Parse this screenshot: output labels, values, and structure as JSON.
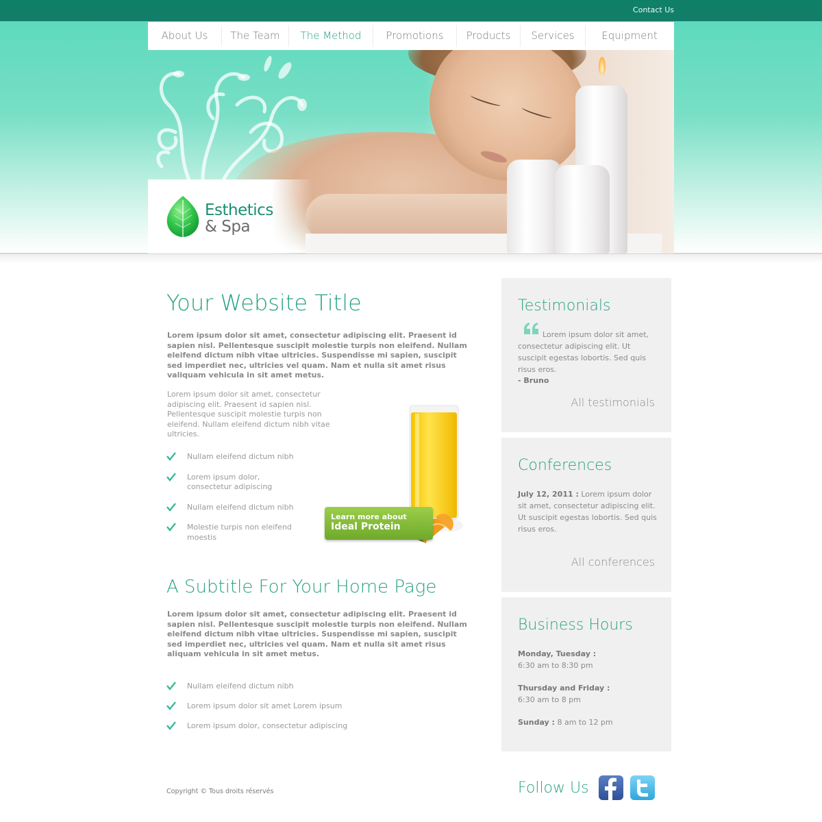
{
  "topbar": {
    "contact_label": "Contact Us"
  },
  "nav": {
    "items": [
      "About Us",
      "The Team",
      "The Method",
      "Promotions",
      "Products",
      "Services",
      "Equipment"
    ],
    "active_index": 2
  },
  "logo": {
    "line1": "Esthetics",
    "line2": "& Spa"
  },
  "main": {
    "title": "Your Website Title",
    "intro_bold": "Lorem ipsum dolor sit amet, consectetur adipiscing elit. Praesent id sapien nisl. Pellentesque suscipit molestie turpis non eleifend. Nullam eleifend dictum nibh vitae ultricies. Suspendisse mi sapien, suscipit sed imperdiet nec, ultricies vel quam. Nam et nulla sit amet risus valiquam vehicula in sit amet metus.",
    "intro_light": "Lorem ipsum dolor sit amet, consectetur adipiscing elit. Praesent id sapien nisl. Pellentesque suscipit molestie turpis non eleifend. Nullam eleifend dictum nibh vitae ultricies.",
    "list1": [
      "Nullam eleifend dictum nibh",
      "Lorem ipsum dolor, consectetur adipiscing",
      "Nullam eleifend dictum nibh",
      "Molestie turpis non eleifend moestis"
    ],
    "promo": {
      "line1": "Learn more about",
      "line2": "Ideal Protein"
    },
    "subtitle": "A Subtitle For Your Home Page",
    "second_bold": "Lorem ipsum dolor sit amet, consectetur adipiscing elit. Praesent id sapien nisl. Pellentesque suscipit molestie turpis non eleifend. Nullam eleifend dictum nibh vitae ultricies. Suspendisse mi sapien, suscipit sed imperdiet nec, ultricies vel quam. Nam et nulla sit amet risus aliquam vehicula in sit amet metus.",
    "list2": [
      "Nullam eleifend dictum nibh",
      "Lorem ipsum dolor sit amet Lorem ipsum",
      "Lorem ipsum dolor, consectetur adipiscing"
    ]
  },
  "sidebar": {
    "testimonials": {
      "title": "Testimonials",
      "quote": "Lorem ipsum dolor sit amet, consectetur adipiscing elit. Ut suscipit egestas lobortis. Sed quis risus eros.",
      "author": "- Bruno",
      "link": "All testimonials"
    },
    "conferences": {
      "title": "Conferences",
      "date": "July 12, 2011 :",
      "text": "Lorem ipsum dolor sit amet, consectetur adipiscing elit. Ut suscipit egestas lobortis. Sed quis risus eros.",
      "link": "All conferences"
    },
    "hours": {
      "title": "Business Hours",
      "rows": [
        {
          "days": "Monday, Tuesday :",
          "time": "6:30 am to 8:30 pm"
        },
        {
          "days": "Thursday and Friday :",
          "time": "6:30 am to 8 pm"
        },
        {
          "days": "Sunday :",
          "time": "8 am to 12 pm"
        }
      ]
    }
  },
  "footer": {
    "copyright": "Copyright © Tous droits réservés",
    "follow_label": "Follow Us",
    "icons": [
      "facebook-icon",
      "twitter-icon"
    ]
  },
  "colors": {
    "accent": "#27a282",
    "topbar": "#0f8068",
    "hero_top": "#5ed9bd",
    "box_bg": "#f0f0f0"
  }
}
